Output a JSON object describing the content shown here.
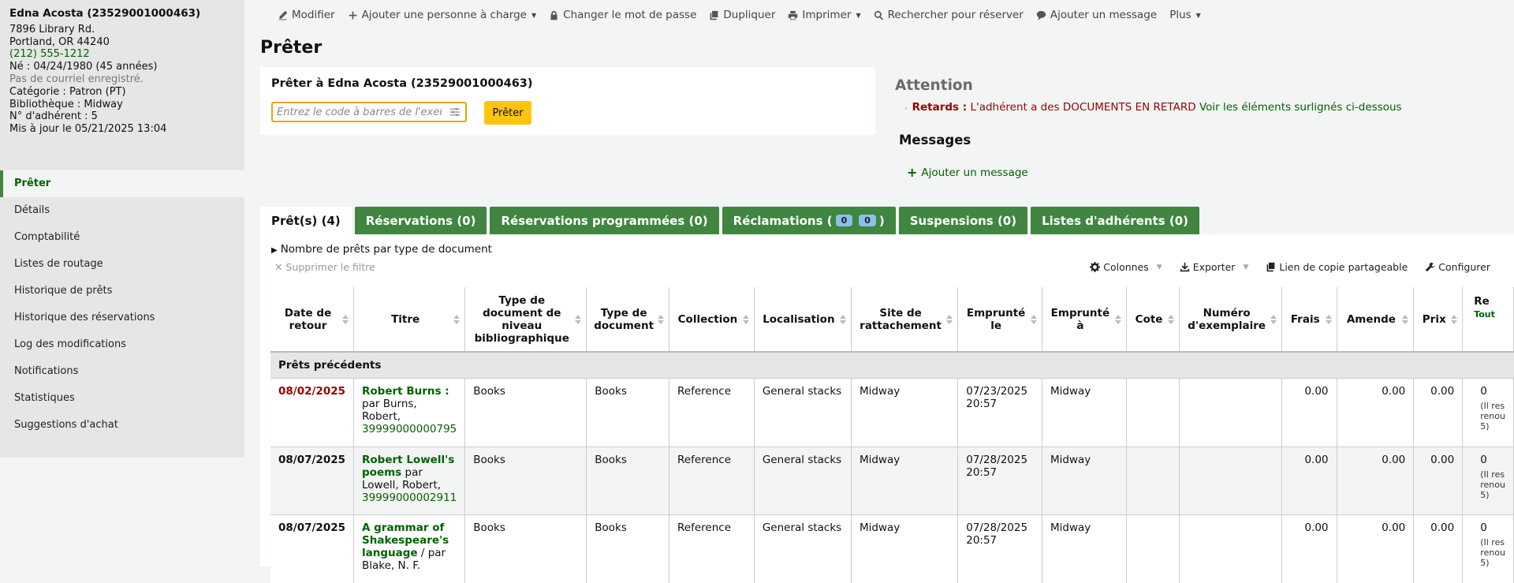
{
  "patron": {
    "name": "Edna Acosta (23529001000463)",
    "address1": "7896 Library Rd.",
    "address2": "Portland, OR 44240",
    "phone": "(212) 555-1212",
    "born": "Né : 04/24/1980 (45 années)",
    "email": "Pas de courriel enregistré.",
    "category": "Catégorie : Patron (PT)",
    "library": "Bibliothèque : Midway",
    "number": "N° d'adhérent : 5",
    "updated": "Mis à jour le 05/21/2025 13:04"
  },
  "nav": [
    {
      "label": "Prêter",
      "name": "nav-preter"
    },
    {
      "label": "Détails",
      "name": "nav-details"
    },
    {
      "label": "Comptabilité",
      "name": "nav-comptabilite"
    },
    {
      "label": "Listes de routage",
      "name": "nav-listes-routage"
    },
    {
      "label": "Historique de prêts",
      "name": "nav-historique-prets"
    },
    {
      "label": "Historique des réservations",
      "name": "nav-historique-reservations"
    },
    {
      "label": "Log des modifications",
      "name": "nav-log-modifications"
    },
    {
      "label": "Notifications",
      "name": "nav-notifications"
    },
    {
      "label": "Statistiques",
      "name": "nav-statistiques"
    },
    {
      "label": "Suggestions d'achat",
      "name": "nav-suggestions-achat"
    }
  ],
  "toolbar": {
    "modifier": "Modifier",
    "ajouter_charge": "Ajouter une personne à charge",
    "changer_mdp": "Changer le mot de passe",
    "dupliquer": "Dupliquer",
    "imprimer": "Imprimer",
    "rechercher": "Rechercher pour réserver",
    "ajouter_message": "Ajouter un message",
    "plus": "Plus"
  },
  "page_title": "Prêter",
  "checkout": {
    "heading": "Prêter à Edna Acosta (23529001000463)",
    "placeholder": "Entrez le code à barres de l'exemplaire",
    "button": "Prêter"
  },
  "attention": {
    "heading": "Attention",
    "label": "Retards :",
    "text": "L'adhérent a des DOCUMENTS EN RETARD",
    "link": "Voir les éléments surlignés ci-dessous"
  },
  "messages": {
    "heading": "Messages",
    "add": "Ajouter un message"
  },
  "tabs": {
    "prets": "Prêt(s) (4)",
    "reservations": "Réservations (0)",
    "programmees": "Réservations programmées (0)",
    "reclamations": "Réclamations (",
    "reclamations_badge1": "0",
    "reclamations_badge2": "0",
    "reclamations_end": ")",
    "suspensions": "Suspensions (0)",
    "listes": "Listes d'adhérents (0)"
  },
  "panel": {
    "summary": "Nombre de prêts par type de document",
    "clear_filter": "Supprimer le filtre",
    "colonnes": "Colonnes",
    "exporter": "Exporter",
    "lien": "Lien de copie partageable",
    "configurer": "Configurer"
  },
  "table": {
    "headers": [
      "Date de retour",
      "Titre",
      "Type de document de niveau bibliographique",
      "Type de document",
      "Collection",
      "Localisation",
      "Site de rattachement",
      "Emprunté le",
      "Emprunté à",
      "Cote",
      "Numéro d'exemplaire",
      "Frais",
      "Amende",
      "Prix",
      "Re",
      "Tout"
    ],
    "group": "Prêts précédents",
    "rows": [
      {
        "due": "08/02/2025",
        "title": "Robert Burns :",
        "by": " par Burns, Robert,",
        "barcode": "39999000000795",
        "bib_type": "Books",
        "type": "Books",
        "collection": "Reference",
        "location": "General stacks",
        "home": "Midway",
        "date_out": "07/23/2025",
        "time_out": "20:57",
        "lib_out": "Midway",
        "cote": "",
        "num": "",
        "frais": "0.00",
        "amende": "0.00",
        "prix": "0.00",
        "renew": "0",
        "renew_note": "(Il res renou 5)"
      },
      {
        "due": "08/07/2025",
        "title": "Robert Lowell's poems",
        "by": " par Lowell, Robert,",
        "barcode": "39999000002911",
        "bib_type": "Books",
        "type": "Books",
        "collection": "Reference",
        "location": "General stacks",
        "home": "Midway",
        "date_out": "07/28/2025",
        "time_out": "20:57",
        "lib_out": "Midway",
        "cote": "",
        "num": "",
        "frais": "0.00",
        "amende": "0.00",
        "prix": "0.00",
        "renew": "0",
        "renew_note": "(Il res renou 5)"
      },
      {
        "due": "08/07/2025",
        "title": "A grammar of Shakespeare's language",
        "by": " / par Blake, N. F.",
        "barcode": "",
        "bib_type": "Books",
        "type": "Books",
        "collection": "Reference",
        "location": "General stacks",
        "home": "Midway",
        "date_out": "07/28/2025",
        "time_out": "20:57",
        "lib_out": "Midway",
        "cote": "",
        "num": "",
        "frais": "0.00",
        "amende": "0.00",
        "prix": "0.00",
        "renew": "0",
        "renew_note": "(Il res renou 5)"
      }
    ]
  },
  "colors": {
    "accent_green": "#408540",
    "link_green": "#006100",
    "overdue_red": "#990000",
    "button_yellow": "#ffc40f"
  }
}
